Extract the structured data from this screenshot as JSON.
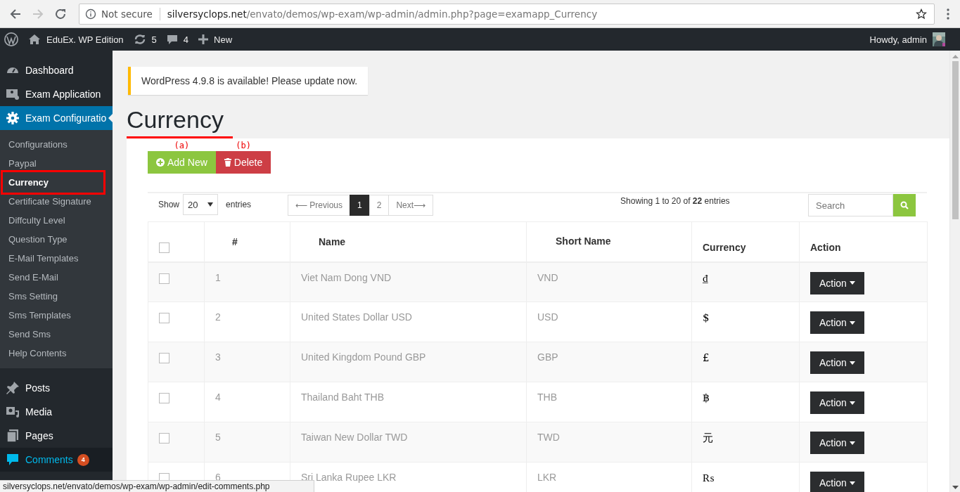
{
  "browser": {
    "security": "Not secure",
    "url_host": "silversyclops.net",
    "url_path": "/envato/demos/wp-exam/wp-admin/admin.php?page=examapp_Currency",
    "forward_disabled": true
  },
  "admin_bar": {
    "site": "EduEx. WP Edition",
    "updates": "5",
    "comments": "4",
    "new": "New",
    "greeting": "Howdy, admin"
  },
  "sidebar": {
    "menu": [
      {
        "label": "Dashboard",
        "selected": false
      },
      {
        "label": "Exam Application",
        "selected": false
      },
      {
        "label": "Exam Configuratio",
        "selected": true
      }
    ],
    "submenu": [
      {
        "label": "Configurations",
        "selected": false,
        "outlined": false
      },
      {
        "label": "Paypal",
        "selected": false,
        "outlined": false
      },
      {
        "label": "Currency",
        "selected": true,
        "outlined": true
      },
      {
        "label": "Certificate Signature",
        "selected": false,
        "outlined": false
      },
      {
        "label": "Diffculty Level",
        "selected": false,
        "outlined": false
      },
      {
        "label": "Question Type",
        "selected": false,
        "outlined": false
      },
      {
        "label": "E-Mail Templates",
        "selected": false,
        "outlined": false
      },
      {
        "label": "Send E-Mail",
        "selected": false,
        "outlined": false
      },
      {
        "label": "Sms Setting",
        "selected": false,
        "outlined": false
      },
      {
        "label": "Sms Templates",
        "selected": false,
        "outlined": false
      },
      {
        "label": "Send Sms",
        "selected": false,
        "outlined": false
      },
      {
        "label": "Help Contents",
        "selected": false,
        "outlined": false
      }
    ],
    "menu_lower": [
      {
        "label": "Posts",
        "hovered": false
      },
      {
        "label": "Media",
        "hovered": false
      },
      {
        "label": "Pages",
        "hovered": false
      },
      {
        "label": "Comments",
        "hovered": true,
        "badge": "4"
      }
    ]
  },
  "notice": {
    "text": "WordPress 4.9.8 is available! Please update now."
  },
  "page_title": {
    "text": "Currency",
    "underlined": true
  },
  "actions": [
    {
      "kind": "add",
      "label": "Add New",
      "annotation": "(a)"
    },
    {
      "kind": "delete",
      "label": "Delete",
      "annotation": "(b)"
    }
  ],
  "table_controls": {
    "show_label": "Show",
    "page_size": "20",
    "entries_label": "entries",
    "info": "Showing 1 to 20 of **22** entries",
    "search_placeholder": "Search",
    "pagination": [
      {
        "label": "⟵ Previous",
        "selected": false
      },
      {
        "label": "1",
        "selected": true
      },
      {
        "label": "2",
        "selected": false
      },
      {
        "label": "Next⟶",
        "selected": false
      }
    ]
  },
  "table": {
    "columns": [
      "#",
      "Name",
      "Short Name",
      "Currency",
      "Action"
    ],
    "select_all_checked": false,
    "rows": [
      {
        "number": "1",
        "name": "Viet Nam Dong VND",
        "short_name": "VND",
        "symbol": "₫",
        "action": "Action",
        "checked": false
      },
      {
        "number": "2",
        "name": "United States Dollar USD",
        "short_name": "USD",
        "symbol": "$",
        "action": "Action",
        "checked": false
      },
      {
        "number": "3",
        "name": "United Kingdom Pound GBP",
        "short_name": "GBP",
        "symbol": "£",
        "action": "Action",
        "checked": false
      },
      {
        "number": "4",
        "name": "Thailand Baht THB",
        "short_name": "THB",
        "symbol": "฿",
        "action": "Action",
        "checked": false
      },
      {
        "number": "5",
        "name": "Taiwan New Dollar TWD",
        "short_name": "TWD",
        "symbol": "元",
        "action": "Action",
        "checked": false
      },
      {
        "number": "6",
        "name": "Sri Lanka Rupee LKR",
        "short_name": "LKR",
        "symbol": "₨",
        "action": "Action",
        "checked": false
      }
    ]
  },
  "status_bar": "silversyclops.net/envato/demos/wp-exam/wp-admin/edit-comments.php"
}
